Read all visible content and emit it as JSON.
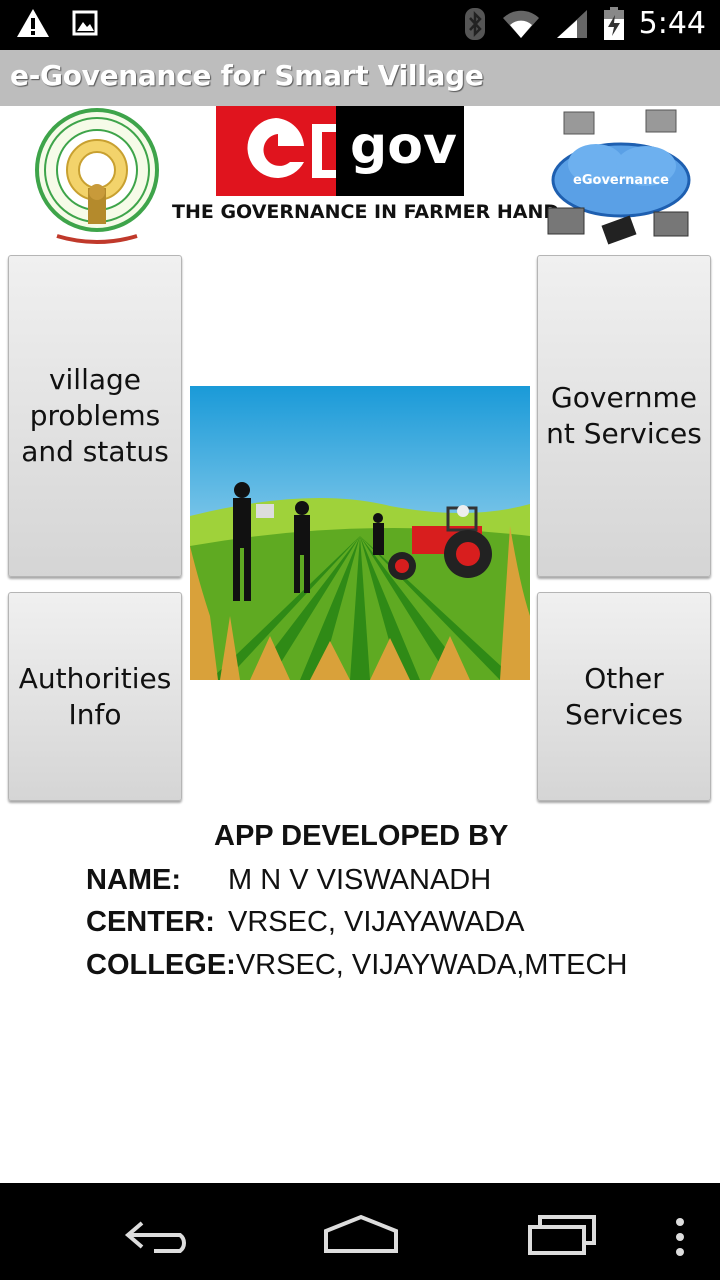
{
  "status_bar": {
    "time": "5:44",
    "left_icons": [
      "warning-icon",
      "image-icon"
    ],
    "right_icons": [
      "bluetooth-icon",
      "wifi-icon",
      "signal-icon",
      "battery-charging-icon"
    ]
  },
  "app": {
    "title": "e-Govenance for Smart Village"
  },
  "header": {
    "logo_text": "gov",
    "tagline": "THE GOVERNANCE IN FARMER HAND",
    "cloud_text": "eGovernance"
  },
  "menu": {
    "village_problems": "village problems and status",
    "government_services": "Government Services",
    "authorities_info": "Authorities Info",
    "other_services": "Other Services"
  },
  "developer": {
    "heading": "APP DEVELOPED BY",
    "name_label": "NAME:",
    "name_value": "M N V VISWANADH",
    "center_label": "CENTER:",
    "center_value": "VRSEC, VIJAYAWADA",
    "college_label": "COLLEGE:",
    "college_value": "VRSEC, VIJAYWADA,MTECH"
  },
  "nav_bar": {
    "icons": [
      "back-icon",
      "home-icon",
      "recents-icon",
      "overflow-menu-icon"
    ]
  },
  "colors": {
    "status_bar": "#000000",
    "title_bar": "#bdbdbd",
    "egov_red": "#e0141e",
    "button_bg": "#e6e6e6"
  }
}
